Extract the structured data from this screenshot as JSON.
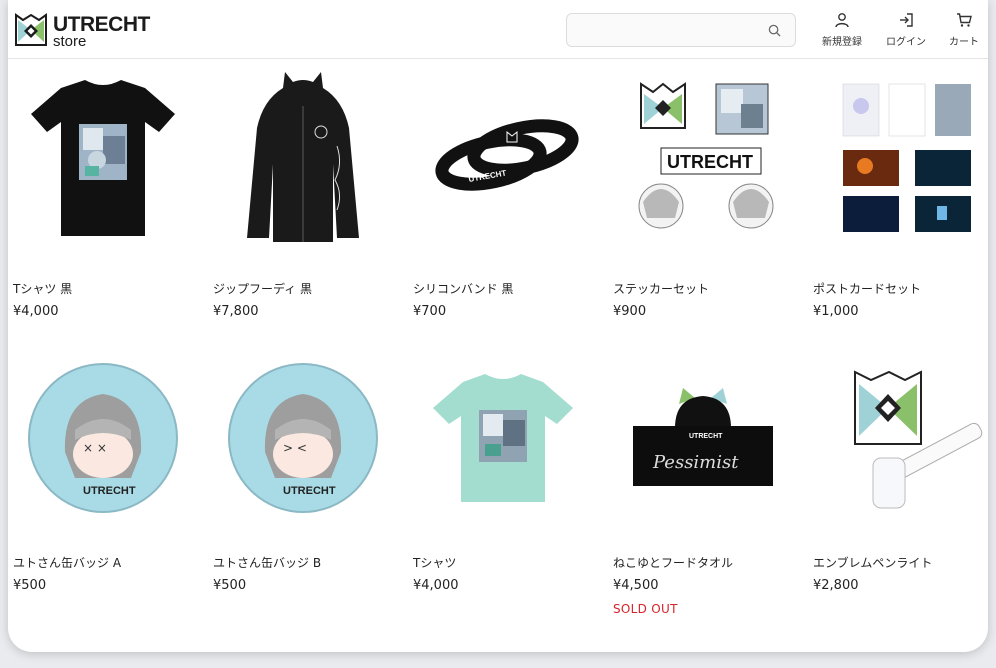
{
  "header": {
    "logo": {
      "line1": "UTRECHT",
      "line2": "store"
    },
    "search": {
      "placeholder": "",
      "icon": "search-icon"
    },
    "nav": [
      {
        "label": "新規登録",
        "icon": "user-icon"
      },
      {
        "label": "ログイン",
        "icon": "login-icon"
      },
      {
        "label": "カート",
        "icon": "cart-icon"
      }
    ]
  },
  "products": [
    {
      "name": "Tシャツ 黒",
      "price": "¥4,000"
    },
    {
      "name": "ジップフーディ 黒",
      "price": "¥7,800"
    },
    {
      "name": "シリコンバンド 黒",
      "price": "¥700"
    },
    {
      "name": "ステッカーセット",
      "price": "¥900"
    },
    {
      "name": "ポストカードセット",
      "price": "¥1,000"
    },
    {
      "name": "ユトさん缶バッジ A",
      "price": "¥500"
    },
    {
      "name": "ユトさん缶バッジ B",
      "price": "¥500"
    },
    {
      "name": "Tシャツ",
      "price": "¥4,000"
    },
    {
      "name": "ねこゆとフードタオル",
      "price": "¥4,500",
      "status": "SOLD OUT"
    },
    {
      "name": "エンブレムペンライト",
      "price": "¥2,800"
    }
  ],
  "artwork_text": {
    "band": "UTRECHT",
    "sticker_logo": "UTRECHT",
    "badge_logo": "UTRECHT",
    "towel_logo": "UTRECHT",
    "towel_script": "Pessimist"
  },
  "colors": {
    "sold_out": "#d9232b",
    "mint": "#a3ddd0",
    "badge_blue": "#a9dbe6"
  }
}
